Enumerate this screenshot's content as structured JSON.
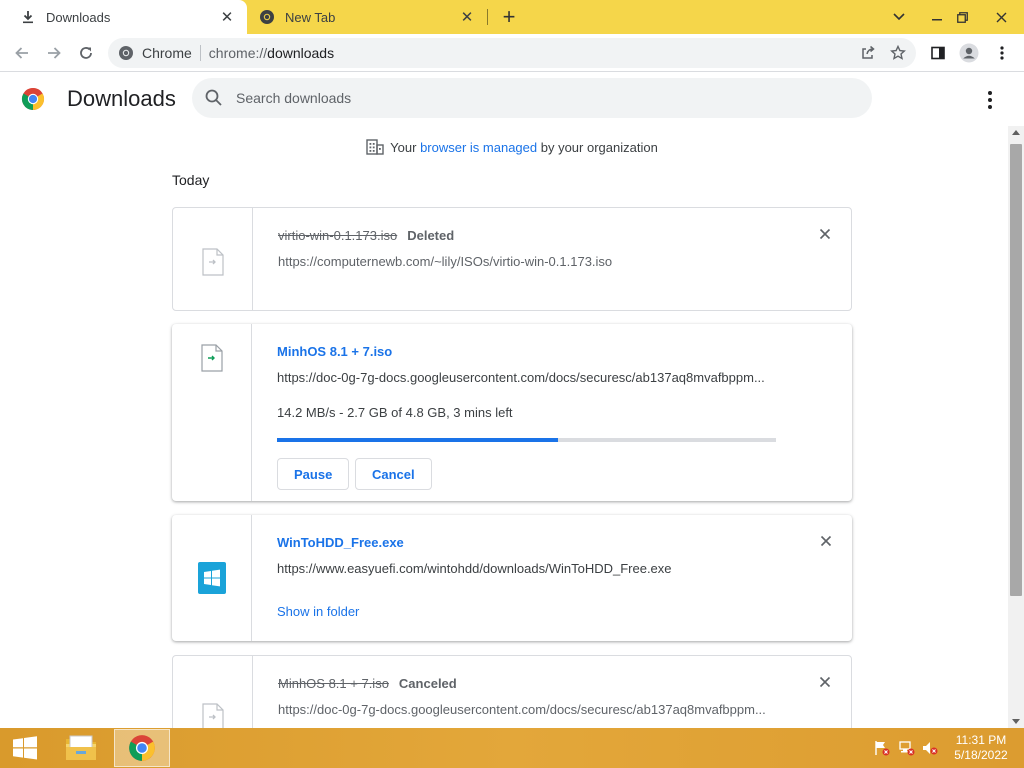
{
  "browser": {
    "tabs": [
      {
        "title": "Downloads",
        "icon": "download-icon",
        "active": true
      },
      {
        "title": "New Tab",
        "icon": "chrome-icon",
        "active": false
      }
    ],
    "omnibox": {
      "site_name": "Chrome",
      "url_scheme": "chrome://",
      "url_path": "downloads"
    },
    "theme_color": "#f5d64a"
  },
  "page": {
    "title": "Downloads",
    "search_placeholder": "Search downloads",
    "managed": {
      "prefix": "Your ",
      "link": "browser is managed",
      "suffix": " by your organization"
    },
    "section": "Today"
  },
  "downloads": [
    {
      "filename": "virtio-win-0.1.173.iso",
      "status": "Deleted",
      "url": "https://computernewb.com/~lily/ISOs/virtio-win-0.1.173.iso"
    },
    {
      "filename": "MinhOS 8.1 + 7.iso",
      "url": "https://doc-0g-7g-docs.googleusercontent.com/docs/securesc/ab137aq8mvafbppm...",
      "progress_text": "14.2 MB/s - 2.7 GB of 4.8 GB, 3 mins left",
      "progress_fraction": 0.5625,
      "pause_label": "Pause",
      "cancel_label": "Cancel"
    },
    {
      "filename": "WinToHDD_Free.exe",
      "url": "https://www.easyuefi.com/wintohdd/downloads/WinToHDD_Free.exe",
      "link_label": "Show in folder"
    },
    {
      "filename": "MinhOS 8.1 + 7.iso",
      "status": "Canceled",
      "url": "https://doc-0g-7g-docs.googleusercontent.com/docs/securesc/ab137aq8mvafbppm..."
    }
  ],
  "taskbar": {
    "time": "11:31 PM",
    "date": "5/18/2022",
    "apps": [
      "file-explorer-icon",
      "chrome-icon"
    ]
  },
  "colors": {
    "accent": "#1a73e8",
    "taskbar": "#e3a73a"
  }
}
